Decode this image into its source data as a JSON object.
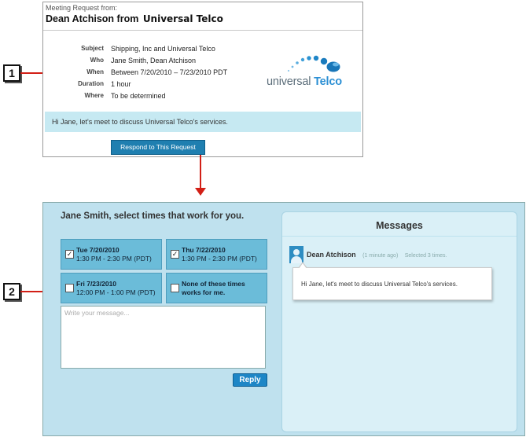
{
  "callouts": [
    "1",
    "2"
  ],
  "email": {
    "from_label": "Meeting Request from:",
    "sender": "Dean Atchison",
    "from_word": "from",
    "company": "Universal Telco",
    "details": [
      {
        "key": "Subject",
        "value": "Shipping, Inc and Universal Telco"
      },
      {
        "key": "Who",
        "value": "Jane Smith, Dean Atchison"
      },
      {
        "key": "When",
        "value": "Between 7/20/2010 – 7/23/2010 PDT"
      },
      {
        "key": "Duration",
        "value": "1 hour"
      },
      {
        "key": "Where",
        "value": "To be determined"
      }
    ],
    "logo": {
      "word1": "universal",
      "word2": "Telco"
    },
    "message": "Hi Jane, let's meet to discuss Universal Telco's services.",
    "respond_button": "Respond to This Request"
  },
  "scheduler": {
    "title": "Jane Smith, select times that work for you.",
    "slots": [
      {
        "checked": true,
        "line1": "Tue 7/20/2010",
        "line2": "1:30 PM - 2:30 PM (PDT)"
      },
      {
        "checked": true,
        "line1": "Thu 7/22/2010",
        "line2": "1:30 PM - 2:30 PM (PDT)"
      },
      {
        "checked": false,
        "line1": "Fri 7/23/2010",
        "line2": "12:00 PM - 1:00 PM (PDT)"
      },
      {
        "checked": false,
        "line1": "None of these times",
        "line2": "works for me."
      }
    ],
    "compose_placeholder": "Write your message...",
    "reply_button": "Reply"
  },
  "messages": {
    "title": "Messages",
    "author": "Dean Atchison",
    "time": "(1 minute ago)",
    "note": "Selected 3 times.",
    "text": "Hi Jane, let's meet to discuss Universal Telco's services."
  },
  "icons": {
    "check": "checkmark-icon",
    "avatar": "person-avatar-icon",
    "logo_dots": "dots-arc-logo-icon"
  },
  "colors": {
    "annotation_red": "#d21f16",
    "accent_blue": "#1f7fb0",
    "panel_blue": "#bfe1ee",
    "slot_blue": "#6bbcd9"
  }
}
